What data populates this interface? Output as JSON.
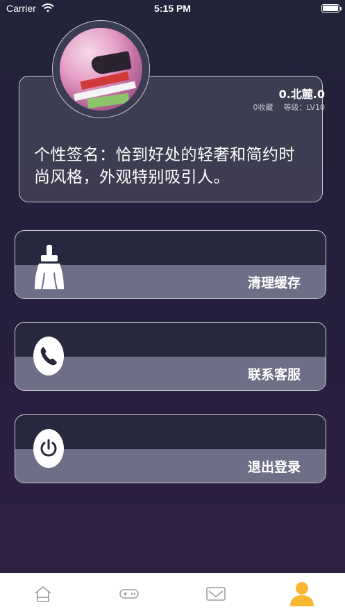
{
  "status_bar": {
    "carrier": "Carrier",
    "time": "5:15 PM"
  },
  "profile": {
    "username": "0.北麓.0",
    "favorites": "0收藏",
    "level": "等级：LV10",
    "signature": "个性签名：恰到好处的轻奢和简约时尚风格，外观特别吸引人。"
  },
  "menu": {
    "clear_cache": "清理缓存",
    "contact_support": "联系客服",
    "logout": "退出登录"
  },
  "tab_bar": {
    "tabs": [
      "home-icon",
      "gamepad-icon",
      "mail-icon",
      "user-icon"
    ],
    "active": "user-icon",
    "active_color": "#f7b733",
    "inactive_color": "#9a9a9a"
  }
}
